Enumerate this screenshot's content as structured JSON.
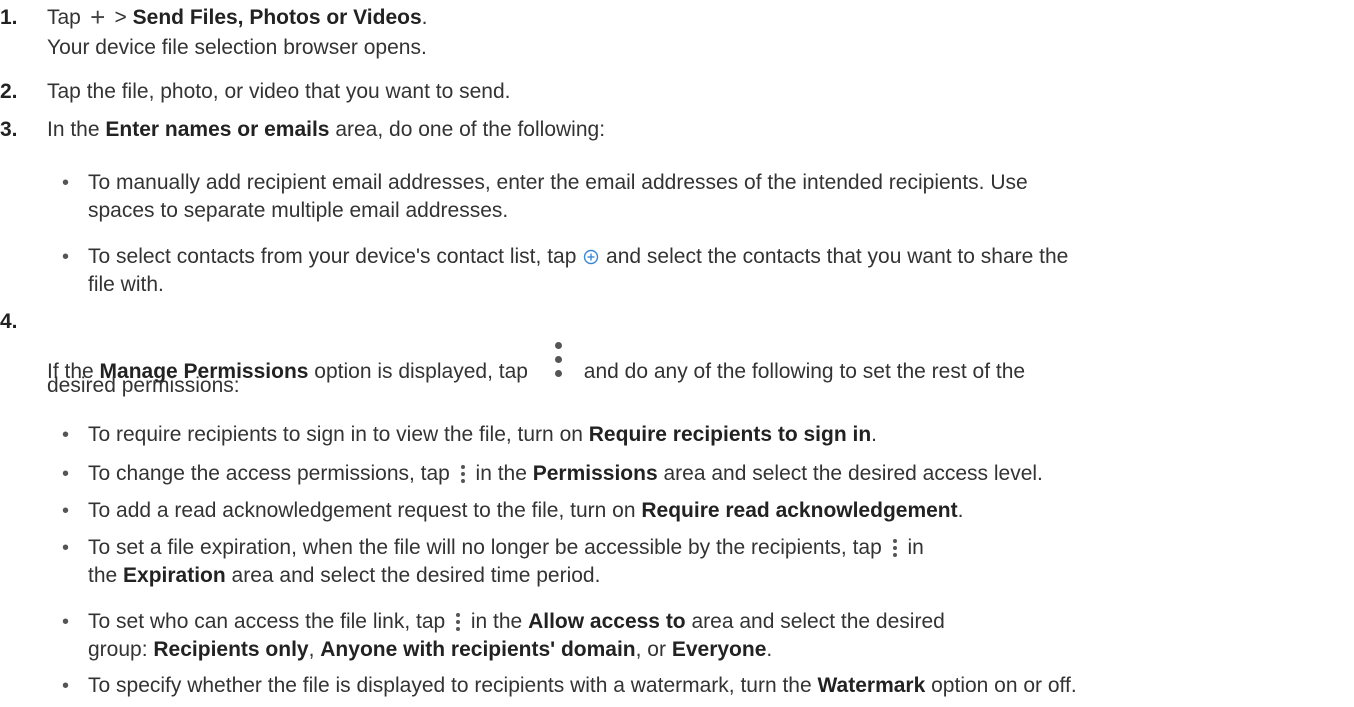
{
  "steps": [
    {
      "num": "1.",
      "a1": "Tap ",
      "b1": "Send Files, Photos or Videos",
      "a1b": " > ",
      "a2": ".",
      "line2": "Your device file selection browser opens."
    },
    {
      "num": "2.",
      "text": "Tap the file, photo, or video that you want to send."
    },
    {
      "num": "3.",
      "a1": "In the ",
      "b1": "Enter names or emails",
      "a2": " area, do one of the following:",
      "bullets": [
        {
          "l1": "To manually add recipient email addresses, enter the email addresses of the intended recipients. Use",
          "l2": "spaces to separate multiple email addresses."
        },
        {
          "l1a": "To select contacts from your device's contact list, tap ",
          "l1b": " and select the contacts that you want to share the",
          "l2": "file with."
        }
      ]
    },
    {
      "num": "4.",
      "a1": "If the ",
      "b1": "Manage Permissions",
      "a2": " option is displayed, tap ",
      "a3": "and do any of the following to set the rest of the",
      "line2": "desired permissions:",
      "bullets": [
        {
          "a": "To require recipients to sign in to view the file, turn on ",
          "b": "Require recipients to sign in",
          "c": "."
        },
        {
          "a": "To change the access permissions, tap ",
          "c": " in the ",
          "b": "Permissions",
          "d": " area and select the desired access level."
        },
        {
          "a": "To add a read acknowledgement request to the file, turn on ",
          "b": "Require read acknowledgement",
          "c": "."
        },
        {
          "a": "To set a file expiration, when the file will no longer be accessible by the recipients, tap ",
          "c": " in",
          "l2a": "the ",
          "l2b": "Expiration",
          "l2c": "  area and select the desired time period."
        },
        {
          "a": "To set who can access the file link, tap ",
          "c": " in the ",
          "b": "Allow access to",
          "d": " area and select the desired",
          "l2a": "group: ",
          "l2b1": "Recipients only",
          "l2c1": ", ",
          "l2b2": "Anyone with recipients' domain",
          "l2c2": ", or ",
          "l2b3": "Everyone",
          "l2c3": "."
        },
        {
          "a": "To specify whether the file is displayed to recipients with a watermark, turn the ",
          "b": "Watermark",
          "c": " option on or off."
        }
      ]
    }
  ],
  "icons": {
    "plus": "plus-icon",
    "add_contact": "add-circle-icon",
    "more": "more-vertical-icon"
  },
  "colors": {
    "text": "#333333",
    "add_icon": "#3a87d9"
  }
}
